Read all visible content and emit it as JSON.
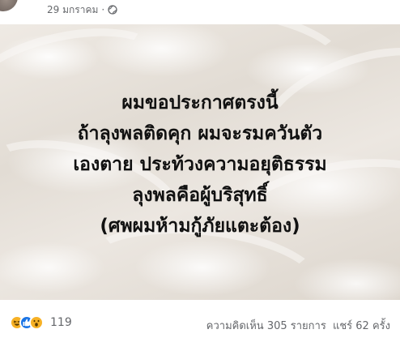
{
  "post": {
    "timestamp": "29 มกราคม",
    "separator": "·",
    "privacy_icon": "globe-icon"
  },
  "image": {
    "lines": [
      "ผมขอประกาศตรงนี้",
      "ถ้าลุงพลติดคุก ผมจะรมควันตัว",
      "เองตาย ประท้วงความอยุติธรรม",
      "ลุงพลคือผู้บริสุทธิ์",
      "(ศพผมห้ามกู้ภัยแตะต้อง)"
    ]
  },
  "reactions": {
    "icons": [
      "haha-icon",
      "like-icon",
      "wow-icon"
    ],
    "count": "119"
  },
  "stats": {
    "comments": "ความคิดเห็น 305 รายการ",
    "shares": "แชร์ 62 ครั้ง"
  },
  "colors": {
    "text_secondary": "#65676b",
    "like_blue": "#1b74e4",
    "reaction_yellow": "#f7b125"
  }
}
